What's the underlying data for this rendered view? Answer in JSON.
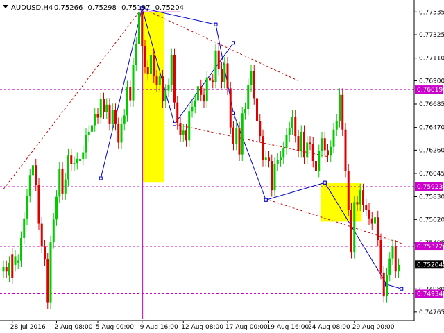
{
  "chart_data": {
    "type": "candlestick",
    "title": "AUDUSD,H4",
    "ohlc_header": {
      "open": "0.75266",
      "high": "0.75298",
      "low": "0.75197",
      "close": "0.75204"
    },
    "ylim": [
      0.747,
      0.7762
    ],
    "y_ticks": [
      "0.77535",
      "0.77325",
      "0.77110",
      "0.76900",
      "0.76685",
      "0.76470",
      "0.76260",
      "0.76045",
      "0.75830",
      "0.75620",
      "0.75405",
      "0.75190",
      "0.74980",
      "0.74765"
    ],
    "x_labels": [
      {
        "label": "28 Jul 2016",
        "bar": 3
      },
      {
        "label": "2 Aug 08:00",
        "bar": 18
      },
      {
        "label": "5 Aug 00:00",
        "bar": 32
      },
      {
        "label": "9 Aug 16:00",
        "bar": 47
      },
      {
        "label": "12 Aug 08:00",
        "bar": 61
      },
      {
        "label": "17 Aug 00:00",
        "bar": 76
      },
      {
        "label": "19 Aug 16:00",
        "bar": 90
      },
      {
        "label": "24 Aug 08:00",
        "bar": 104
      },
      {
        "label": "29 Aug 00:00",
        "bar": 119
      }
    ],
    "bar_count": 135,
    "colors": {
      "bull": "#00cc00",
      "bear": "#dd0000",
      "structure": "#0000cc",
      "level": "#cc00cc",
      "channel": "#cc0000",
      "zone": "#ffff00",
      "price_tag": "#000000"
    },
    "candles_close": [
      0.7518,
      0.7514,
      0.7522,
      0.7508,
      0.7528,
      0.7524,
      0.7545,
      0.7563,
      0.7584,
      0.7603,
      0.7612,
      0.7594,
      0.7558,
      0.7537,
      0.7525,
      0.7485,
      0.7541,
      0.7562,
      0.7583,
      0.7609,
      0.7586,
      0.7599,
      0.7621,
      0.7613,
      0.7614,
      0.7618,
      0.7618,
      0.7624,
      0.764,
      0.7643,
      0.7649,
      0.7659,
      0.7656,
      0.7673,
      0.7661,
      0.7668,
      0.765,
      0.7663,
      0.765,
      0.7633,
      0.765,
      0.7658,
      0.7684,
      0.7672,
      0.7705,
      0.7724,
      0.7753,
      0.7722,
      0.7703,
      0.7696,
      0.7714,
      0.7694,
      0.7686,
      0.7694,
      0.7671,
      0.7681,
      0.7686,
      0.7714,
      0.767,
      0.7651,
      0.764,
      0.7644,
      0.7635,
      0.7662,
      0.7666,
      0.7672,
      0.7685,
      0.7677,
      0.7671,
      0.7693,
      0.769,
      0.7689,
      0.7718,
      0.7701,
      0.7689,
      0.7706,
      0.7683,
      0.7647,
      0.7632,
      0.7646,
      0.7622,
      0.766,
      0.7664,
      0.7686,
      0.7699,
      0.7674,
      0.7653,
      0.7639,
      0.7617,
      0.7619,
      0.7616,
      0.7589,
      0.7613,
      0.7617,
      0.7619,
      0.7628,
      0.764,
      0.7646,
      0.7657,
      0.7639,
      0.7625,
      0.7643,
      0.7619,
      0.7633,
      0.7632,
      0.7616,
      0.7607,
      0.7625,
      0.7637,
      0.7626,
      0.7621,
      0.7629,
      0.7645,
      0.7653,
      0.7677,
      0.7645,
      0.7607,
      0.7571,
      0.7532,
      0.7578,
      0.7576,
      0.7589,
      0.7575,
      0.7571,
      0.7563,
      0.7558,
      0.7564,
      0.7543,
      0.7513,
      0.7491,
      0.7511,
      0.7526,
      0.7537,
      0.7514,
      0.752
    ],
    "candles_open": [
      0.7514,
      0.7518,
      0.751,
      0.753,
      0.752,
      0.7522,
      0.7524,
      0.7545,
      0.7563,
      0.7584,
      0.7603,
      0.7612,
      0.7594,
      0.7558,
      0.7537,
      0.7525,
      0.7485,
      0.7541,
      0.7562,
      0.7583,
      0.7609,
      0.7586,
      0.7599,
      0.7621,
      0.7613,
      0.7614,
      0.7616,
      0.7618,
      0.7624,
      0.764,
      0.7643,
      0.7649,
      0.7659,
      0.7656,
      0.7673,
      0.7661,
      0.7668,
      0.765,
      0.7663,
      0.765,
      0.7633,
      0.765,
      0.7658,
      0.7684,
      0.7672,
      0.7705,
      0.7724,
      0.7753,
      0.7722,
      0.7703,
      0.7696,
      0.7714,
      0.7694,
      0.7686,
      0.7694,
      0.7671,
      0.7681,
      0.7686,
      0.7714,
      0.767,
      0.7651,
      0.764,
      0.7644,
      0.7635,
      0.7662,
      0.7666,
      0.7672,
      0.7685,
      0.7677,
      0.7671,
      0.7693,
      0.769,
      0.7689,
      0.7718,
      0.7701,
      0.7689,
      0.7706,
      0.7683,
      0.7647,
      0.7632,
      0.7646,
      0.7622,
      0.766,
      0.7664,
      0.7686,
      0.7699,
      0.7674,
      0.7653,
      0.7639,
      0.7617,
      0.7619,
      0.7616,
      0.7589,
      0.7613,
      0.7617,
      0.7619,
      0.7628,
      0.764,
      0.7646,
      0.7657,
      0.7639,
      0.7625,
      0.7643,
      0.7619,
      0.7633,
      0.7632,
      0.7616,
      0.7607,
      0.7625,
      0.7637,
      0.7626,
      0.7621,
      0.7629,
      0.7645,
      0.7653,
      0.7677,
      0.7645,
      0.7607,
      0.7571,
      0.7532,
      0.7578,
      0.7576,
      0.7589,
      0.7575,
      0.7571,
      0.7563,
      0.7558,
      0.7564,
      0.7543,
      0.7513,
      0.7491,
      0.7511,
      0.7526,
      0.7537,
      0.7514
    ],
    "levels": [
      {
        "label": "0.76819",
        "value": 0.76819
      },
      {
        "label": "0.75923",
        "value": 0.75923
      },
      {
        "label": "0.75372",
        "value": 0.75372
      },
      {
        "label": "0.74934",
        "value": 0.74934
      }
    ],
    "current_price": {
      "label": "0.75204",
      "value": 0.75204
    },
    "zones": [
      {
        "x0": 47.2,
        "x1": 54.5,
        "y0": 0.77535,
        "y1": 0.7596
      },
      {
        "x0": 107.5,
        "x1": 121.5,
        "y0": 0.75955,
        "y1": 0.756
      }
    ],
    "structure_lines": [
      [
        [
          33,
          0.76
        ],
        [
          47,
          0.7757
        ]
      ],
      [
        [
          47,
          0.7757
        ],
        [
          58,
          0.765
        ]
      ],
      [
        [
          47,
          0.7757
        ],
        [
          72,
          0.7742
        ]
      ],
      [
        [
          58,
          0.765
        ],
        [
          78,
          0.7725
        ]
      ],
      [
        [
          72,
          0.7742
        ],
        [
          78,
          0.766
        ]
      ],
      [
        [
          78,
          0.766
        ],
        [
          89,
          0.758
        ]
      ],
      [
        [
          89,
          0.758
        ],
        [
          109,
          0.7596
        ]
      ],
      [
        [
          109,
          0.7596
        ],
        [
          130,
          0.7502
        ]
      ],
      [
        [
          130,
          0.7502
        ],
        [
          135,
          0.7498
        ]
      ]
    ],
    "channel_lines": [
      [
        [
          0,
          0.759
        ],
        [
          47,
          0.7757
        ]
      ],
      [
        [
          47,
          0.7757
        ],
        [
          100,
          0.769
        ]
      ],
      [
        [
          58,
          0.765
        ],
        [
          110,
          0.762
        ]
      ],
      [
        [
          90,
          0.758
        ],
        [
          135,
          0.754
        ]
      ]
    ]
  }
}
